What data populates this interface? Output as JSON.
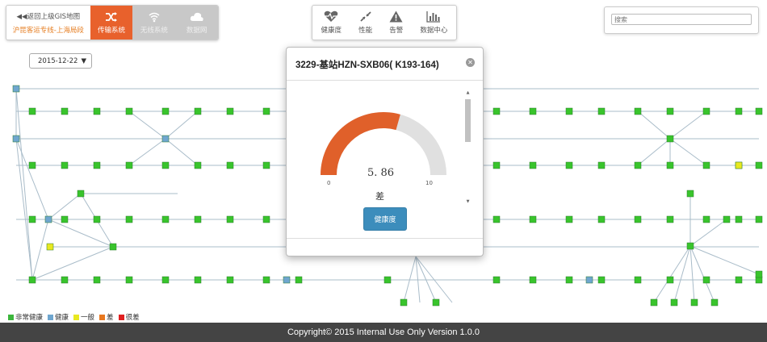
{
  "header": {
    "back_link": "◀◀返回上级GIS地图",
    "line_name": "沪昆客运专线-上海局段",
    "systems": [
      {
        "label": "传输系统",
        "state": "active",
        "icon": "shuffle-icon"
      },
      {
        "label": "无线系统",
        "state": "disabled",
        "icon": "wifi-icon"
      },
      {
        "label": "数据网",
        "state": "disabled",
        "icon": "cloud-icon"
      }
    ],
    "tools": [
      {
        "label": "健康度",
        "icon": "heartbeat-icon"
      },
      {
        "label": "性能",
        "icon": "compress-arrows-icon"
      },
      {
        "label": "告警",
        "icon": "warning-icon"
      },
      {
        "label": "数据中心",
        "icon": "bar-chart-icon"
      }
    ],
    "search_placeholder": "搜索"
  },
  "date_select": {
    "value": "2015-12-22"
  },
  "popup": {
    "title": "3229-基站HZN-SXB06( K193-164)",
    "gauge_value": 5.86,
    "gauge_value_text": "5. 86",
    "gauge_min": "0",
    "gauge_max": "10",
    "status": "差",
    "button": "健康度",
    "colors": {
      "fill": "#e0602a",
      "track": "#e0e0e0"
    }
  },
  "legend": [
    {
      "label": "非常健康",
      "color": "#3cb63c"
    },
    {
      "label": "健康",
      "color": "#6fa6cf"
    },
    {
      "label": "一般",
      "color": "#e8e820"
    },
    {
      "label": "差",
      "color": "#e87820"
    },
    {
      "label": "很差",
      "color": "#e02020"
    }
  ],
  "footer": "Copyright© 2015 Internal Use Only Version 1.0.0"
}
